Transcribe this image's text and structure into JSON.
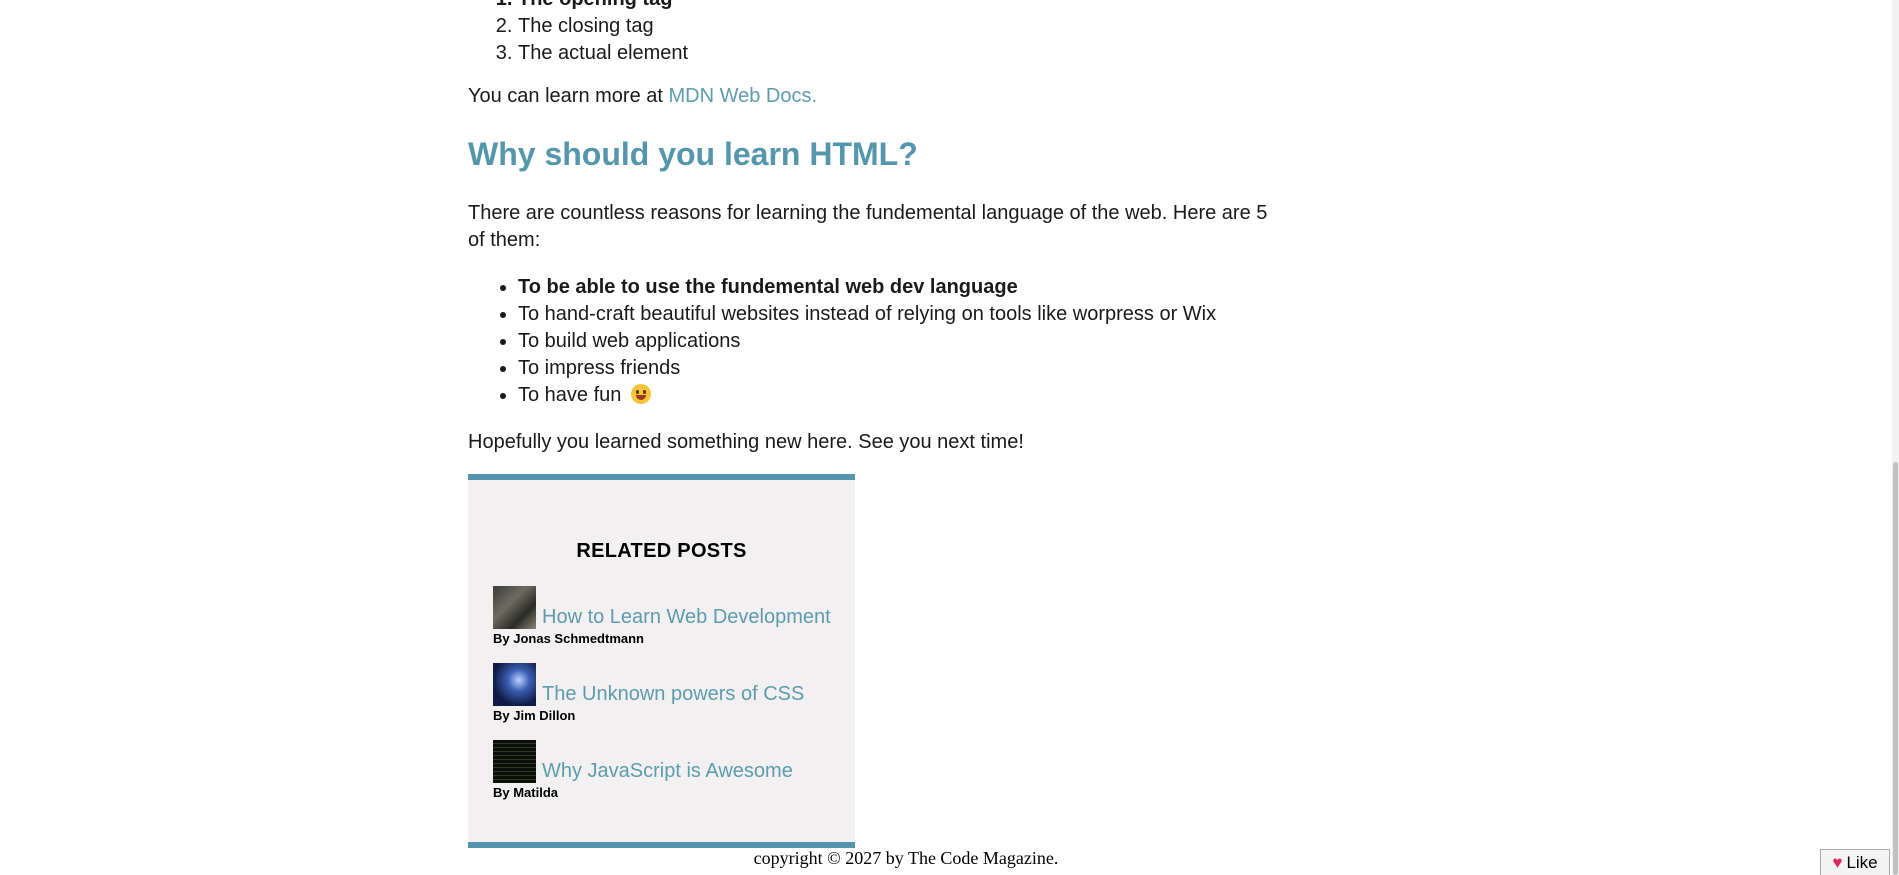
{
  "steps": [
    "The opening tag",
    "The closing tag",
    "The actual element"
  ],
  "learn_more": {
    "prefix": "You can learn more at ",
    "link_text": "MDN Web Docs."
  },
  "section_heading": "Why should you learn HTML?",
  "intro_text": "There are countless reasons for learning the fundemental language of the web. Here are 5 of them:",
  "reasons": [
    "To be able to use the fundemental web dev language",
    "To hand-craft beautiful websites instead of relying on tools like worpress or Wix",
    "To build web applications",
    "To impress friends",
    "To have fun"
  ],
  "reasons_icons": {
    "fun": "grinning-face-emoji"
  },
  "closing_text": "Hopefully you learned something new here. See you next time!",
  "related": {
    "heading": "RELATED POSTS",
    "posts": [
      {
        "title": "How to Learn Web Development",
        "author": "By Jonas Schmedtmann"
      },
      {
        "title": "The Unknown powers of CSS",
        "author": "By Jim Dillon"
      },
      {
        "title": "Why JavaScript is Awesome",
        "author": "By Matilda"
      }
    ]
  },
  "footer_text": "copyright © 2027 by The Code Magazine.",
  "like_button": {
    "label": "Like",
    "icon": "heart-icon"
  },
  "colors": {
    "accent": "#5496ab",
    "link": "#5d9cad",
    "panel_bg": "#f2f0f0"
  }
}
